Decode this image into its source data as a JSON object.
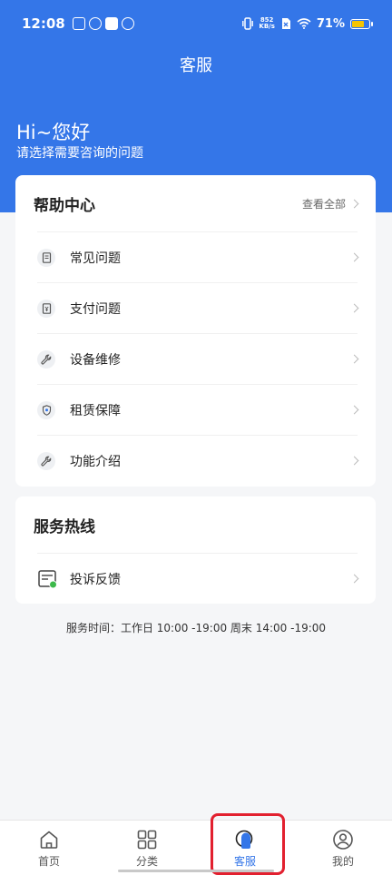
{
  "status_bar": {
    "time": "12:08",
    "net_speed_value": "852",
    "net_speed_unit": "KB/s",
    "battery": "71%"
  },
  "header": {
    "title": "客服",
    "greeting": "Hi~您好",
    "subtitle": "请选择需要咨询的问题"
  },
  "help_center": {
    "title": "帮助中心",
    "view_all": "查看全部",
    "items": [
      {
        "label": "常见问题",
        "icon": "document-icon"
      },
      {
        "label": "支付问题",
        "icon": "receipt-icon"
      },
      {
        "label": "设备维修",
        "icon": "wrench-icon"
      },
      {
        "label": "租赁保障",
        "icon": "shield-icon"
      },
      {
        "label": "功能介绍",
        "icon": "wrench-icon"
      }
    ]
  },
  "hotline": {
    "title": "服务热线",
    "items": [
      {
        "label": "投诉反馈",
        "icon": "feedback-form-icon"
      }
    ]
  },
  "service_time": "服务时间：工作日 10:00 -19:00 周末 14:00 -19:00",
  "tabbar": {
    "active": "客服",
    "tabs": [
      {
        "label": "首页",
        "icon": "home-icon"
      },
      {
        "label": "分类",
        "icon": "grid-icon"
      },
      {
        "label": "客服",
        "icon": "customer-service-icon"
      },
      {
        "label": "我的",
        "icon": "user-icon"
      }
    ]
  },
  "colors": {
    "primary": "#3476e8",
    "highlight": "#e2202f",
    "background": "#f5f6f8"
  }
}
